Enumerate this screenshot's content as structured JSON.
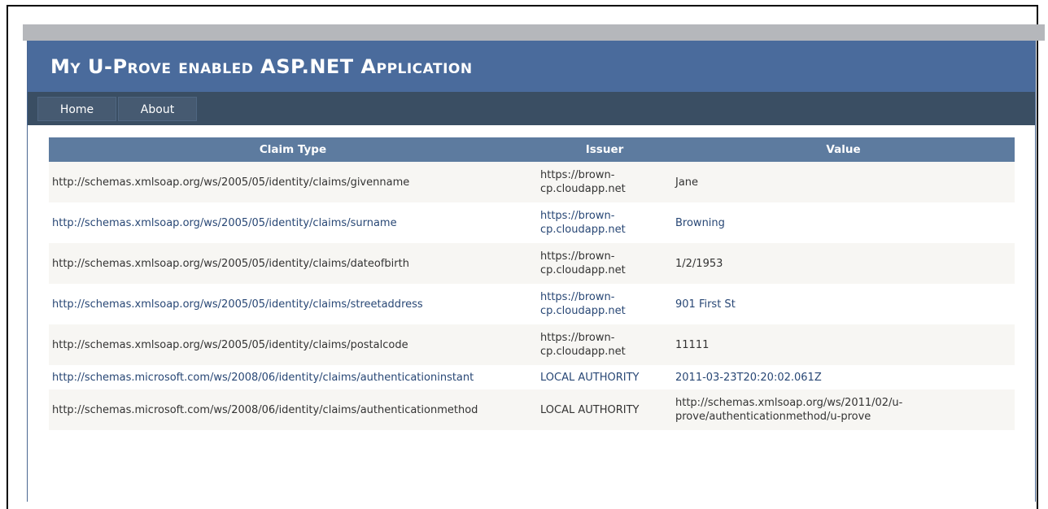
{
  "app": {
    "title": "My U-Prove enabled ASP.NET Application"
  },
  "nav": {
    "items": [
      {
        "label": "Home"
      },
      {
        "label": "About"
      }
    ]
  },
  "table": {
    "columns": [
      "Claim Type",
      "Issuer",
      "Value"
    ],
    "rows": [
      {
        "claim_type": "http://schemas.xmlsoap.org/ws/2005/05/identity/claims/givenname",
        "issuer": "https://brown-cp.cloudapp.net",
        "value": "Jane"
      },
      {
        "claim_type": "http://schemas.xmlsoap.org/ws/2005/05/identity/claims/surname",
        "issuer": "https://brown-cp.cloudapp.net",
        "value": "Browning"
      },
      {
        "claim_type": "http://schemas.xmlsoap.org/ws/2005/05/identity/claims/dateofbirth",
        "issuer": "https://brown-cp.cloudapp.net",
        "value": "1/2/1953"
      },
      {
        "claim_type": "http://schemas.xmlsoap.org/ws/2005/05/identity/claims/streetaddress",
        "issuer": "https://brown-cp.cloudapp.net",
        "value": "901 First St"
      },
      {
        "claim_type": "http://schemas.xmlsoap.org/ws/2005/05/identity/claims/postalcode",
        "issuer": "https://brown-cp.cloudapp.net",
        "value": "11111"
      },
      {
        "claim_type": "http://schemas.microsoft.com/ws/2008/06/identity/claims/authenticationinstant",
        "issuer": "LOCAL AUTHORITY",
        "value": "2011-03-23T20:20:02.061Z"
      },
      {
        "claim_type": "http://schemas.microsoft.com/ws/2008/06/identity/claims/authenticationmethod",
        "issuer": "LOCAL AUTHORITY",
        "value": "http://schemas.xmlsoap.org/ws/2011/02/u-prove/authenticationmethod/u-prove"
      }
    ]
  },
  "colors": {
    "header_bg": "#4a6b9c",
    "nav_bg": "#3a4e63",
    "table_header_bg": "#5d7b9f",
    "row_alt_bg": "#f7f6f3",
    "row_link_color": "#284775"
  }
}
